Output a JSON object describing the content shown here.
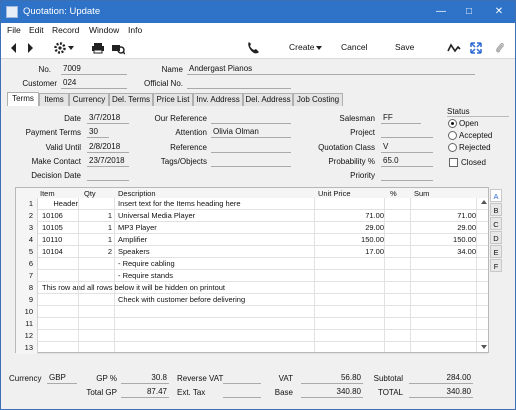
{
  "window": {
    "title": "Quotation: Update"
  },
  "menu": [
    "File",
    "Edit",
    "Record",
    "Window",
    "Info"
  ],
  "toolbar": {
    "create": "Create",
    "cancel": "Cancel",
    "save": "Save"
  },
  "header": {
    "no_label": "No.",
    "no_value": "7009",
    "name_label": "Name",
    "name_value": "Andergast Pianos",
    "customer_label": "Customer",
    "customer_value": "024",
    "official_label": "Official No.",
    "official_value": ""
  },
  "tabs": [
    "Terms",
    "Items",
    "Currency",
    "Del. Terms",
    "Price List",
    "Inv. Address",
    "Del. Address",
    "Job Costing"
  ],
  "terms": {
    "date_label": "Date",
    "date_value": "3/7/2018",
    "payment_label": "Payment Terms",
    "payment_value": "30",
    "valid_label": "Valid Until",
    "valid_value": "2/8/2018",
    "contact_label": "Make Contact",
    "contact_value": "23/7/2018",
    "decision_label": "Decision Date",
    "decision_value": "",
    "ourref_label": "Our Reference",
    "ourref_value": "",
    "attention_label": "Attention",
    "attention_value": "Olivia Olman",
    "reference_label": "Reference",
    "reference_value": "",
    "tags_label": "Tags/Objects",
    "tags_value": "",
    "salesman_label": "Salesman",
    "salesman_value": "FF",
    "project_label": "Project",
    "project_value": "",
    "qclass_label": "Quotation Class",
    "qclass_value": "V",
    "prob_label": "Probability %",
    "prob_value": "65.0",
    "priority_label": "Priority",
    "priority_value": ""
  },
  "status": {
    "label": "Status",
    "options": [
      "Open",
      "Accepted",
      "Rejected"
    ],
    "selected": "Open",
    "closed_label": "Closed",
    "closed": false
  },
  "grid": {
    "columns": [
      "Item",
      "Qty",
      "Description",
      "Unit Price",
      "%",
      "Sum"
    ],
    "rows": [
      {
        "n": "1",
        "item": "Header",
        "qty": "",
        "desc": "Insert text for the Items heading here",
        "price": "",
        "pct": "",
        "sum": ""
      },
      {
        "n": "2",
        "item": "10106",
        "qty": "1",
        "desc": "Universal Media Player",
        "price": "71.00",
        "pct": "",
        "sum": "71.00"
      },
      {
        "n": "3",
        "item": "10105",
        "qty": "1",
        "desc": "MP3 Player",
        "price": "29.00",
        "pct": "",
        "sum": "29.00"
      },
      {
        "n": "4",
        "item": "10110",
        "qty": "1",
        "desc": "Amplifier",
        "price": "150.00",
        "pct": "",
        "sum": "150.00"
      },
      {
        "n": "5",
        "item": "10104",
        "qty": "2",
        "desc": "Speakers",
        "price": "17.00",
        "pct": "",
        "sum": "34.00"
      },
      {
        "n": "6",
        "item": "",
        "qty": "",
        "desc": "- Require cabling",
        "price": "",
        "pct": "",
        "sum": ""
      },
      {
        "n": "7",
        "item": "",
        "qty": "",
        "desc": "- Require stands",
        "price": "",
        "pct": "",
        "sum": ""
      },
      {
        "n": "8",
        "item": "This row and all rows below it will be hidden on printout",
        "qty": "",
        "desc": "",
        "price": "",
        "pct": "",
        "sum": ""
      },
      {
        "n": "9",
        "item": "",
        "qty": "",
        "desc": "Check with customer before delivering",
        "price": "",
        "pct": "",
        "sum": ""
      },
      {
        "n": "10",
        "item": "",
        "qty": "",
        "desc": "",
        "price": "",
        "pct": "",
        "sum": ""
      },
      {
        "n": "11",
        "item": "",
        "qty": "",
        "desc": "",
        "price": "",
        "pct": "",
        "sum": ""
      },
      {
        "n": "12",
        "item": "",
        "qty": "",
        "desc": "",
        "price": "",
        "pct": "",
        "sum": ""
      },
      {
        "n": "13",
        "item": "",
        "qty": "",
        "desc": "",
        "price": "",
        "pct": "",
        "sum": ""
      }
    ],
    "side_tabs": [
      "A",
      "B",
      "C",
      "D",
      "E",
      "F"
    ]
  },
  "footer": {
    "currency_label": "Currency",
    "currency_value": "GBP",
    "gp_label": "GP %",
    "gp_value": "30.8",
    "totalgp_label": "Total GP",
    "totalgp_value": "87.47",
    "revvat_label": "Reverse VAT",
    "revvat_value": "",
    "exttax_label": "Ext. Tax",
    "exttax_value": "",
    "vat_label": "VAT",
    "vat_value": "56.80",
    "base_label": "Base",
    "base_value": "340.80",
    "subtotal_label": "Subtotal",
    "subtotal_value": "284.00",
    "total_label": "TOTAL",
    "total_value": "340.80"
  },
  "colors": {
    "titlebar": "#2f73c8",
    "accent": "#2f6bd0"
  }
}
